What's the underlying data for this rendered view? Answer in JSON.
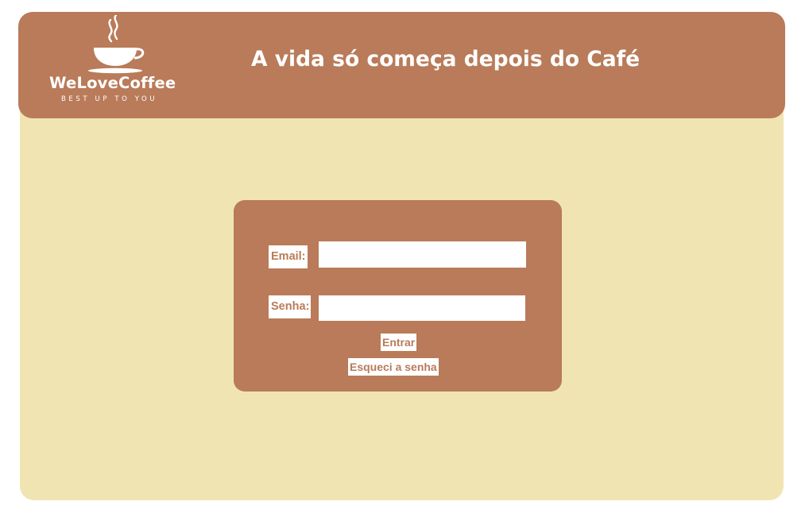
{
  "brand": {
    "name": "WeLoveCoffee",
    "tagline": "BEST UP TO YOU",
    "logo_icon": "coffee-cup-icon"
  },
  "header": {
    "headline": "A vida só começa depois do Café"
  },
  "login": {
    "email_label": "Email:",
    "email_value": "",
    "email_placeholder": "",
    "password_label": "Senha:",
    "password_value": "",
    "password_placeholder": "",
    "submit_label": "Entrar",
    "forgot_label": "Esqueci a senha"
  },
  "colors": {
    "header_bg": "#b97b59",
    "content_bg": "#f0e4b2",
    "card_bg": "#b97b59",
    "accent_text": "#b97b59",
    "white": "#ffffff"
  }
}
